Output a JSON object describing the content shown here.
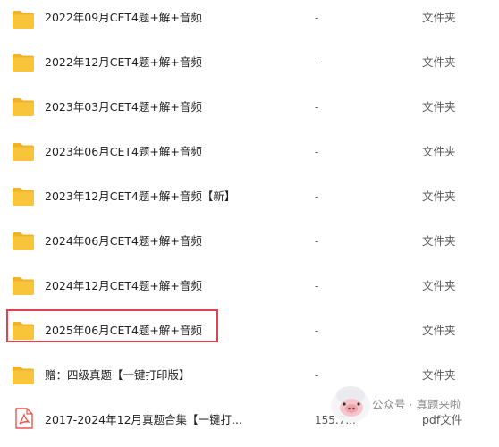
{
  "files": [
    {
      "name": "2022年09月CET4题+解+音频",
      "size": "-",
      "type": "文件夹",
      "icon": "folder-icon"
    },
    {
      "name": "2022年12月CET4题+解+音频",
      "size": "-",
      "type": "文件夹",
      "icon": "folder-icon"
    },
    {
      "name": "2023年03月CET4题+解+音频",
      "size": "-",
      "type": "文件夹",
      "icon": "folder-icon"
    },
    {
      "name": "2023年06月CET4题+解+音频",
      "size": "-",
      "type": "文件夹",
      "icon": "folder-icon"
    },
    {
      "name": "2023年12月CET4题+解+音频【新】",
      "size": "-",
      "type": "文件夹",
      "icon": "folder-icon"
    },
    {
      "name": "2024年06月CET4题+解+音频",
      "size": "-",
      "type": "文件夹",
      "icon": "folder-icon"
    },
    {
      "name": "2024年12月CET4题+解+音频",
      "size": "-",
      "type": "文件夹",
      "icon": "folder-icon"
    },
    {
      "name": "2025年06月CET4题+解+音频",
      "size": "-",
      "type": "文件夹",
      "icon": "folder-icon",
      "highlighted": true
    },
    {
      "name": "赠：四级真题【一键打印版】",
      "size": "-",
      "type": "文件夹",
      "icon": "folder-icon"
    },
    {
      "name": "2017-2024年12月真题合集【一键打...",
      "size": "155.7...",
      "type": "pdf文件",
      "icon": "pdf-icon"
    }
  ],
  "watermark": {
    "text": "公众号 · 真题来啦",
    "icon": "mascot-icon"
  },
  "colors": {
    "folder": "#f8c53a",
    "folder_back": "#f0b22a",
    "pdf": "#e8574f",
    "highlight": "#e0424e"
  }
}
